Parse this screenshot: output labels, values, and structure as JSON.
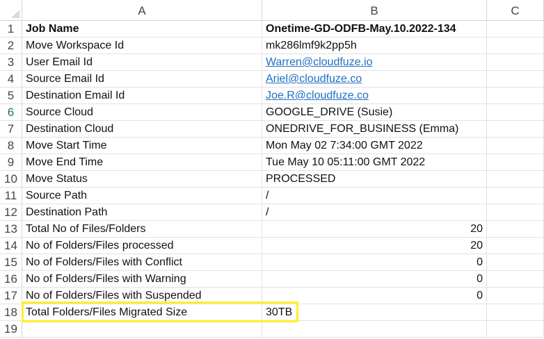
{
  "columns": [
    "A",
    "B",
    "C"
  ],
  "rows": [
    {
      "num": "1",
      "label": "Job Name",
      "value": "Onetime-GD-ODFB-May.10.2022-134"
    },
    {
      "num": "2",
      "label": "Move Workspace Id",
      "value": "mk286lmf9k2pp5h"
    },
    {
      "num": "3",
      "label": "User Email Id",
      "value": "Warren@cloudfuze.io"
    },
    {
      "num": "4",
      "label": "Source Email Id",
      "value": "Ariel@cloudfuze.co"
    },
    {
      "num": "5",
      "label": "Destination Email Id",
      "value": "Joe.R@cloudfuze.co"
    },
    {
      "num": "6",
      "label": "Source Cloud",
      "value": "GOOGLE_DRIVE (Susie)"
    },
    {
      "num": "7",
      "label": "Destination Cloud",
      "value": "ONEDRIVE_FOR_BUSINESS (Emma)"
    },
    {
      "num": "8",
      "label": "Move Start Time",
      "value": "Mon May 02 7:34:00 GMT 2022"
    },
    {
      "num": "9",
      "label": "Move End Time",
      "value": "Tue May 10 05:11:00 GMT 2022"
    },
    {
      "num": "10",
      "label": "Move Status",
      "value": "PROCESSED"
    },
    {
      "num": "11",
      "label": "Source Path",
      "value": "/"
    },
    {
      "num": "12",
      "label": "Destination Path",
      "value": "/"
    },
    {
      "num": "13",
      "label": "Total No of Files/Folders",
      "value": "20"
    },
    {
      "num": "14",
      "label": "No of Folders/Files processed",
      "value": "20"
    },
    {
      "num": "15",
      "label": "No of Folders/Files with Conflict",
      "value": "0"
    },
    {
      "num": "16",
      "label": "No of Folders/Files with Warning",
      "value": "0"
    },
    {
      "num": "17",
      "label": "No of Folders/Files with Suspended",
      "value": "0"
    },
    {
      "num": "18",
      "label": "Total Folders/Files Migrated Size",
      "value": "30TB"
    },
    {
      "num": "19",
      "label": "",
      "value": ""
    }
  ],
  "colors": {
    "highlight": "#ffef2a",
    "link": "#1f6fc0",
    "selected_row_header": "#217346"
  }
}
